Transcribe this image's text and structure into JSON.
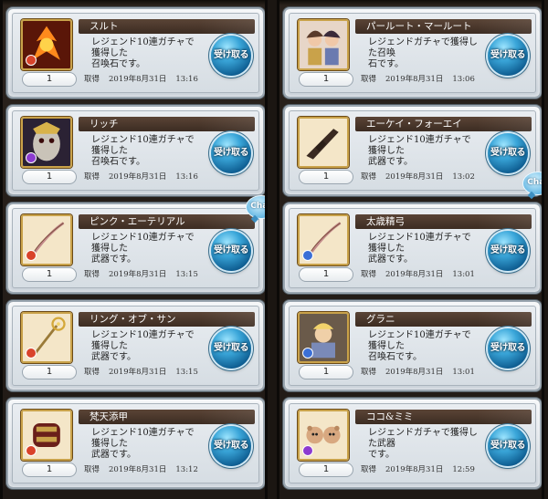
{
  "claim_label": "受け取る",
  "chat_label": "Chat",
  "obtained_label": "取得",
  "left_column": [
    {
      "name": "スルト",
      "desc_line1": "レジェンド10連ガチャで獲得した",
      "desc_line2": "召喚石です。",
      "qty": "1",
      "date": "2019年8月31日",
      "time": "13:16",
      "art": "fire-summon",
      "badge": "#d9432a"
    },
    {
      "name": "リッチ",
      "desc_line1": "レジェンド10連ガチャで獲得した",
      "desc_line2": "召喚石です。",
      "qty": "1",
      "date": "2019年8月31日",
      "time": "13:16",
      "art": "dark-summon",
      "badge": "#8c3bd0"
    },
    {
      "name": "ピンク・エーテリアル",
      "desc_line1": "レジェンド10連ガチャで獲得した",
      "desc_line2": "武器です。",
      "qty": "1",
      "date": "2019年8月31日",
      "time": "13:15",
      "art": "bow-weapon",
      "badge": "#d9432a"
    },
    {
      "name": "リング・オブ・サン",
      "desc_line1": "レジェンド10連ガチャで獲得した",
      "desc_line2": "武器です。",
      "qty": "1",
      "date": "2019年8月31日",
      "time": "13:15",
      "art": "staff-weapon",
      "badge": "#d9432a"
    },
    {
      "name": "梵天添甲",
      "desc_line1": "レジェンド10連ガチャで獲得した",
      "desc_line2": "武器です。",
      "qty": "1",
      "date": "2019年8月31日",
      "time": "13:12",
      "art": "gauntlet-weapon",
      "badge": "#d9432a"
    }
  ],
  "right_column": [
    {
      "name": "パールート・マールート",
      "desc_line1": "レジェンドガチャで獲得した召喚",
      "desc_line2": "石です。",
      "qty": "1",
      "date": "2019年8月31日",
      "time": "13:06",
      "art": "twins-summon",
      "badge": ""
    },
    {
      "name": "エーケイ・フォーエイ",
      "desc_line1": "レジェンド10連ガチャで獲得した",
      "desc_line2": "武器です。",
      "qty": "1",
      "date": "2019年8月31日",
      "time": "13:02",
      "art": "gun-weapon",
      "badge": ""
    },
    {
      "name": "太歳精弓",
      "desc_line1": "レジェンド10連ガチャで獲得した",
      "desc_line2": "武器です。",
      "qty": "1",
      "date": "2019年8月31日",
      "time": "13:01",
      "art": "bow-weapon",
      "badge": "#3b6fd6"
    },
    {
      "name": "グラニ",
      "desc_line1": "レジェンド10連ガチャで獲得した",
      "desc_line2": "召喚石です。",
      "qty": "1",
      "date": "2019年8月31日",
      "time": "13:01",
      "art": "water-summon",
      "badge": "#3b6fd6"
    },
    {
      "name": "ココ&ミミ",
      "desc_line1": "レジェンドガチャで獲得した武器",
      "desc_line2": "です。",
      "qty": "1",
      "date": "2019年8月31日",
      "time": "12:59",
      "art": "bears-weapon",
      "badge": "#8c3bd0"
    }
  ]
}
